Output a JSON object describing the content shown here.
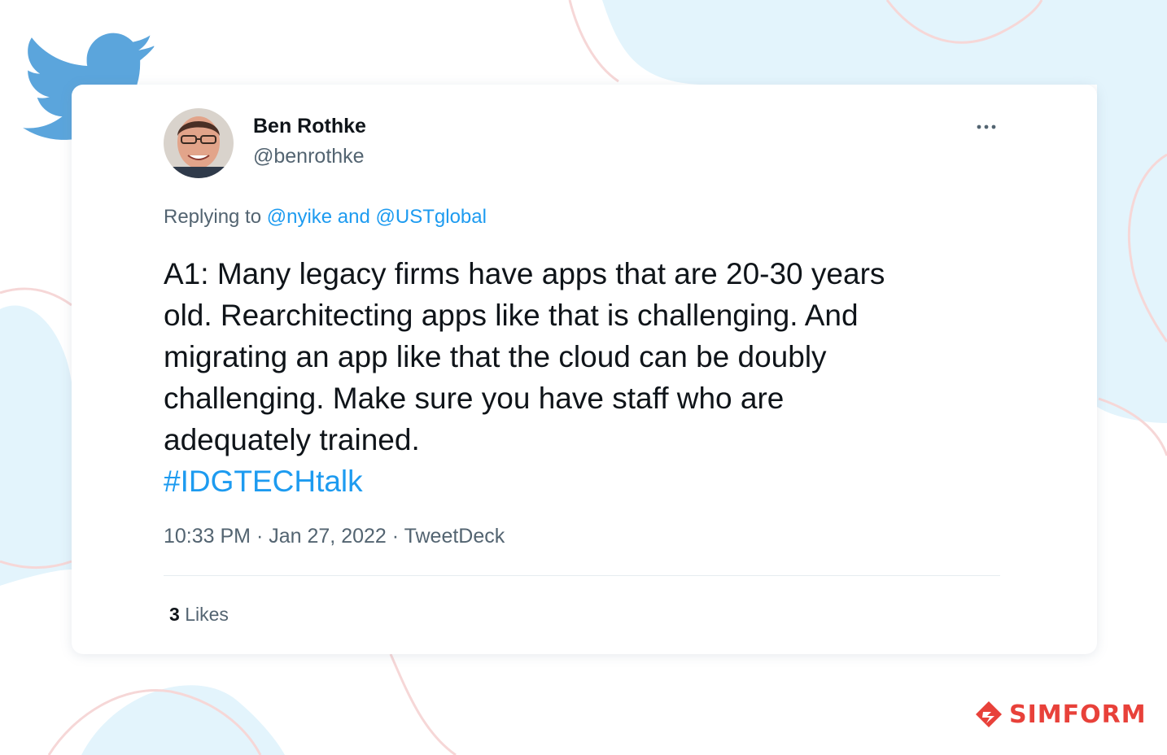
{
  "tweet": {
    "author_name": "Ben Rothke",
    "author_handle": "@benrothke",
    "reply_prefix": "Replying to",
    "reply_mentions": "@nyike and @USTglobal",
    "text_lines": [
      "A1: Many legacy firms have apps that are 20-30 years",
      "old. Rearchitecting apps like that is challenging. And",
      "migrating an app like that the cloud can be doubly",
      "challenging. Make sure you have staff who are",
      "adequately trained."
    ],
    "hashtag": "#IDGTECHtalk",
    "time": "10:33 PM",
    "date": "Jan 27, 2022",
    "source": "TweetDeck",
    "separator": "·",
    "likes_count": "3",
    "likes_label": "Likes",
    "more_icon": "ellipsis-icon",
    "avatar_icon": "avatar"
  },
  "branding": {
    "twitter_logo_icon": "twitter-bird-icon",
    "simform_text": "SIMFORM",
    "simform_icon": "simform-logo-icon"
  },
  "colors": {
    "twitter_blue": "#1d9bf0",
    "logo_blue": "#5ba5dc",
    "text_primary": "#0f1419",
    "text_secondary": "#536471",
    "background_blob": "#e3f4fc",
    "brand_red": "#e8413a"
  }
}
